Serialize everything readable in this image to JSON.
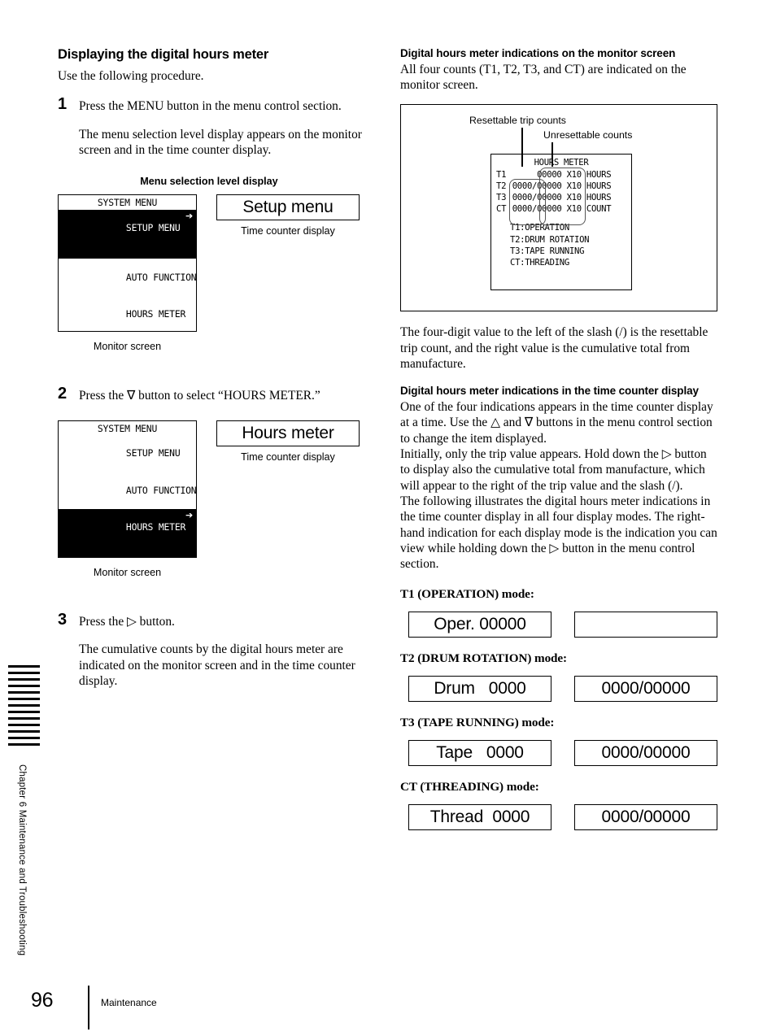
{
  "chapter_tab": {
    "label": "Chapter 6  Maintenance and Troubleshooting"
  },
  "footer": {
    "page_number": "96",
    "section": "Maintenance"
  },
  "left_column": {
    "heading": "Displaying the digital hours meter",
    "intro": "Use the following procedure.",
    "steps": [
      {
        "number": "1",
        "title": "Press the MENU button in the menu control section.",
        "body": "The menu selection level display appears on the monitor screen and in the time counter display."
      },
      {
        "number": "2",
        "title": "Press the ∇ button to select “HOURS METER.”"
      },
      {
        "number": "3",
        "title": "Press the ▷ button.",
        "body": "The cumulative counts by the digital hours meter are indicated on the monitor screen and in the time counter display."
      }
    ],
    "figure1": {
      "caption_top": "Menu selection level display",
      "caption_bottom": "Monitor screen",
      "monitor": {
        "title": "SYSTEM MENU",
        "rows": [
          {
            "label": "SETUP MENU",
            "selected": true,
            "arrow": "➔"
          },
          {
            "label": "AUTO FUNCTION",
            "selected": false,
            "arrow": ""
          },
          {
            "label": "HOURS METER",
            "selected": false,
            "arrow": ""
          }
        ]
      },
      "time_counter": {
        "value": "Setup menu",
        "caption": "Time counter display"
      }
    },
    "figure2": {
      "caption_bottom": "Monitor screen",
      "monitor": {
        "title": "SYSTEM MENU",
        "rows": [
          {
            "label": "SETUP MENU",
            "selected": false,
            "arrow": ""
          },
          {
            "label": "AUTO FUNCTION",
            "selected": false,
            "arrow": ""
          },
          {
            "label": "HOURS METER",
            "selected": true,
            "arrow": "➔"
          }
        ]
      },
      "time_counter": {
        "value": "Hours meter",
        "caption": "Time counter display"
      }
    }
  },
  "right_column": {
    "monitor_section": {
      "heading": "Digital hours meter indications on the monitor screen",
      "body": "All four counts (T1, T2, T3, and CT) are indicated on the monitor screen.",
      "diagram": {
        "callout_left": "Resettable trip counts",
        "callout_right": "Unresettable counts",
        "title": "HOURS METER",
        "rows": [
          {
            "id": "T1",
            "trip": "",
            "slash": " ",
            "cumulative": "00000",
            "unit": "X10 HOURS"
          },
          {
            "id": "T2",
            "trip": "0000",
            "slash": "/",
            "cumulative": "00000",
            "unit": "X10 HOURS"
          },
          {
            "id": "T3",
            "trip": "0000",
            "slash": "/",
            "cumulative": "00000",
            "unit": "X10 HOURS"
          },
          {
            "id": "CT",
            "trip": "0000",
            "slash": "/",
            "cumulative": "00000",
            "unit": "X10 COUNT"
          }
        ],
        "legend": [
          "T1:OPERATION",
          "T2:DRUM ROTATION",
          "T3:TAPE RUNNING",
          "CT:THREADING"
        ]
      },
      "note": "The four-digit value to the left of the slash (/) is the resettable trip count, and the right value is the cumulative total from manufacture."
    },
    "counter_section": {
      "heading": "Digital hours meter indications in the time counter display",
      "paragraphs": [
        "One of the four indications appears in the time counter display at a time. Use the △ and ∇ buttons in the menu control section to change the item displayed.",
        "Initially, only the trip value appears. Hold down the ▷ button to display also the cumulative total from manufacture, which will appear to the right of the trip value and the slash (/).",
        "The following illustrates the digital hours meter indications in the time counter display in all four display modes. The right-hand indication for each display mode is the indication you can view while holding down the ▷ button in the menu control section."
      ],
      "modes": [
        {
          "heading": "T1 (OPERATION) mode:",
          "trip_display": "Oper. 00000",
          "cumulative_display": ""
        },
        {
          "heading": "T2 (DRUM ROTATION) mode:",
          "trip_display": "Drum   0000",
          "cumulative_display": "0000/00000"
        },
        {
          "heading": "T3 (TAPE RUNNING) mode:",
          "trip_display": "Tape   0000",
          "cumulative_display": "0000/00000"
        },
        {
          "heading": "CT (THREADING) mode:",
          "trip_display": "Thread  0000",
          "cumulative_display": "0000/00000"
        }
      ]
    }
  }
}
